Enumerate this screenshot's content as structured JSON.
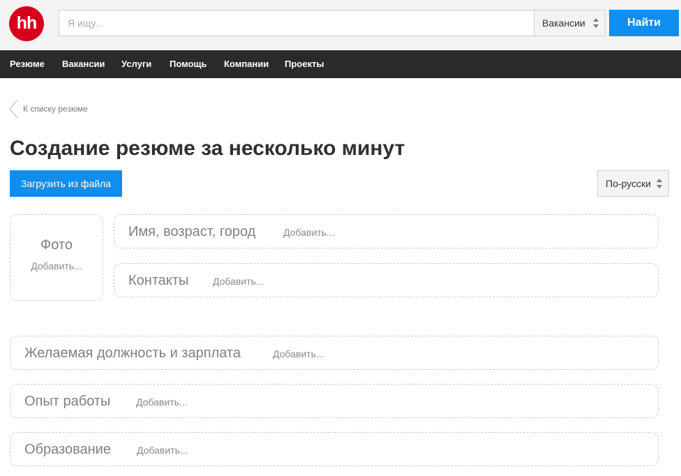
{
  "header": {
    "logo_text": "hh",
    "search": {
      "placeholder": "Я ищу...",
      "value": ""
    },
    "category": "Вакансии",
    "find_label": "Найти"
  },
  "nav": {
    "items": [
      {
        "label": "Резюме"
      },
      {
        "label": "Вакансии"
      },
      {
        "label": "Услуги"
      },
      {
        "label": "Помощь"
      },
      {
        "label": "Компании"
      },
      {
        "label": "Проекты"
      }
    ]
  },
  "breadcrumb": {
    "label": "К списку резюме"
  },
  "page": {
    "title": "Создание резюме за несколько минут",
    "upload_label": "Загрузить из файла",
    "language": "По-русски"
  },
  "sections": {
    "photo": {
      "title": "Фото",
      "add": "Добавить..."
    },
    "personal": {
      "title": "Имя, возраст, город",
      "add": "Добавить..."
    },
    "contacts": {
      "title": "Контакты",
      "add": "Добавить..."
    },
    "position": {
      "title": "Желаемая должность и зарплата",
      "add": "Добавить..."
    },
    "experience": {
      "title": "Опыт работы",
      "add": "Добавить..."
    },
    "education": {
      "title": "Образование",
      "add": "Добавить..."
    }
  },
  "colors": {
    "brand_red": "#d6001c",
    "accent_blue": "#0f8ef0",
    "nav_bg": "#2a2a2a",
    "header_bg": "#f4f4f4"
  },
  "icons": {
    "select_arrows": "updown-arrows-icon",
    "back": "chevron-left-icon"
  }
}
